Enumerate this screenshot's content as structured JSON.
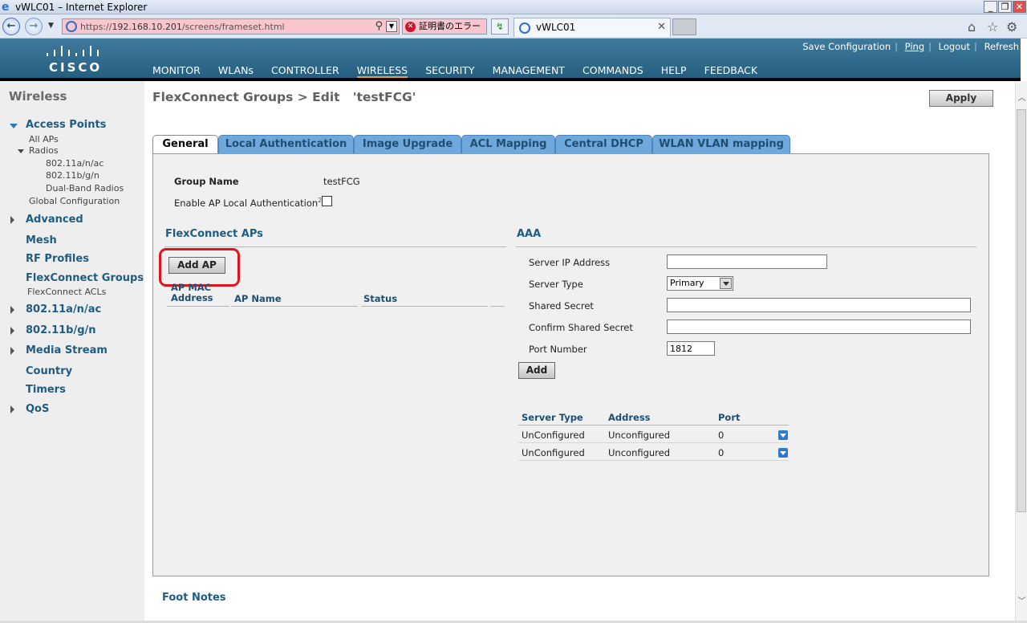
{
  "browser": {
    "window_title": "vWLC01 – Internet Explorer",
    "url_prefix": "https://",
    "url_host": "192.168.10.201",
    "url_path": "/screens/frameset.html",
    "cert_error": "証明書のエラー",
    "tab_title": "vWLC01"
  },
  "header": {
    "brand": "CISCO",
    "nav": [
      "MONITOR",
      "WLANs",
      "CONTROLLER",
      "WIRELESS",
      "SECURITY",
      "MANAGEMENT",
      "COMMANDS",
      "HELP",
      "FEEDBACK"
    ],
    "active_nav": "WIRELESS",
    "links": [
      "Save Configuration",
      "Ping",
      "Logout",
      "Refresh"
    ]
  },
  "sidebar": {
    "title": "Wireless",
    "access_points": "Access Points",
    "all_aps": "All APs",
    "radios": "Radios",
    "radio_items": [
      "802.11a/n/ac",
      "802.11b/g/n",
      "Dual-Band Radios"
    ],
    "global_config": "Global Configuration",
    "advanced": "Advanced",
    "mesh": "Mesh",
    "rf_profiles": "RF Profiles",
    "flexconnect_groups": "FlexConnect Groups",
    "flexconnect_acls": "FlexConnect ACLs",
    "s_80211a": "802.11a/n/ac",
    "s_80211b": "802.11b/g/n",
    "media_stream": "Media Stream",
    "country": "Country",
    "timers": "Timers",
    "qos": "QoS"
  },
  "page": {
    "title": "FlexConnect Groups > Edit   'testFCG'",
    "apply": "Apply",
    "tabs": [
      "General",
      "Local Authentication",
      "Image Upgrade",
      "ACL Mapping",
      "Central DHCP",
      "WLAN VLAN mapping"
    ],
    "group_name_label": "Group Name",
    "group_name_value": "testFCG",
    "enable_local_auth_label": "Enable AP Local Authentication",
    "enable_local_auth_note": "2",
    "flex_aps_title": "FlexConnect APs",
    "add_ap": "Add AP",
    "ap_table_headers": [
      "AP MAC Address",
      "AP Name",
      "Status"
    ],
    "aaa_title": "AAA",
    "server_ip_label": "Server IP Address",
    "server_ip_value": "",
    "server_type_label": "Server Type",
    "server_type_value": "Primary",
    "shared_secret_label": "Shared Secret",
    "confirm_secret_label": "Confirm Shared Secret",
    "port_label": "Port Number",
    "port_value": "1812",
    "add": "Add",
    "server_table_headers": [
      "Server Type",
      "Address",
      "Port"
    ],
    "server_rows": [
      {
        "type": "UnConfigured",
        "address": "Unconfigured",
        "port": "0"
      },
      {
        "type": "UnConfigured",
        "address": "Unconfigured",
        "port": "0"
      }
    ],
    "foot_notes": "Foot Notes"
  }
}
